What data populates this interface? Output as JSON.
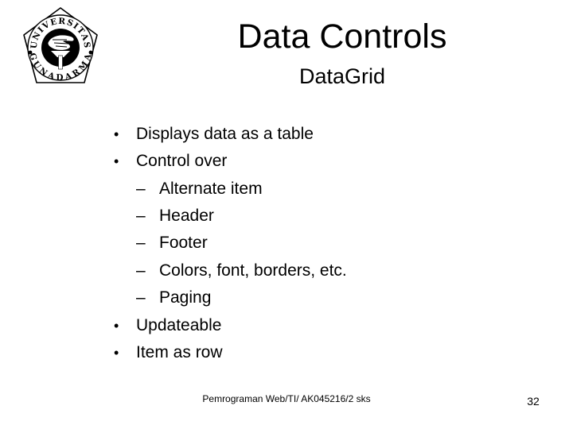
{
  "slide": {
    "logo": {
      "icon": "university-gunadarma-seal-icon",
      "top_text": "UNIVERSITAS",
      "bottom_text": "GUNADARMA"
    },
    "title": "Data Controls",
    "subtitle": "DataGrid",
    "items": [
      {
        "level": 1,
        "marker": "•",
        "text": "Displays data as a table"
      },
      {
        "level": 1,
        "marker": "•",
        "text": "Control over"
      },
      {
        "level": 2,
        "marker": "–",
        "text": "Alternate item"
      },
      {
        "level": 2,
        "marker": "–",
        "text": "Header"
      },
      {
        "level": 2,
        "marker": "–",
        "text": "Footer"
      },
      {
        "level": 2,
        "marker": "–",
        "text": "Colors, font, borders, etc."
      },
      {
        "level": 2,
        "marker": "–",
        "text": "Paging"
      },
      {
        "level": 1,
        "marker": "•",
        "text": "Updateable"
      },
      {
        "level": 1,
        "marker": "•",
        "text": "Item as row"
      }
    ],
    "footer": "Pemrograman Web/TI/ AK045216/2 sks",
    "page_number": "32"
  }
}
